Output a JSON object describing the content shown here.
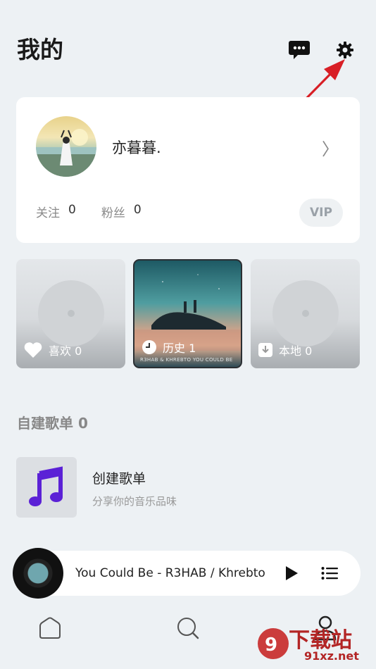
{
  "header": {
    "title": "我的"
  },
  "profile": {
    "username": "亦暮暮.",
    "following_label": "关注",
    "following_count": "0",
    "fans_label": "粉丝",
    "fans_count": "0",
    "vip_label": "VIP"
  },
  "tiles": [
    {
      "label": "喜欢 0",
      "icon": "heart-icon"
    },
    {
      "label": "历史 1",
      "icon": "clock-icon",
      "caption": "R3HAB & KHREBTO YOU COULD BE"
    },
    {
      "label": "本地 0",
      "icon": "download-icon"
    }
  ],
  "playlists": {
    "section_title": "自建歌单 0",
    "create_title": "创建歌单",
    "create_subtitle": "分享你的音乐品味"
  },
  "player": {
    "track": "You Could Be - R3HAB / Khrebto"
  },
  "watermark": {
    "text": "下载站",
    "url": "91xz.net"
  },
  "colors": {
    "accent_purple": "#5b21d6",
    "annotation_red": "#d81f26",
    "background": "#edf1f4"
  }
}
